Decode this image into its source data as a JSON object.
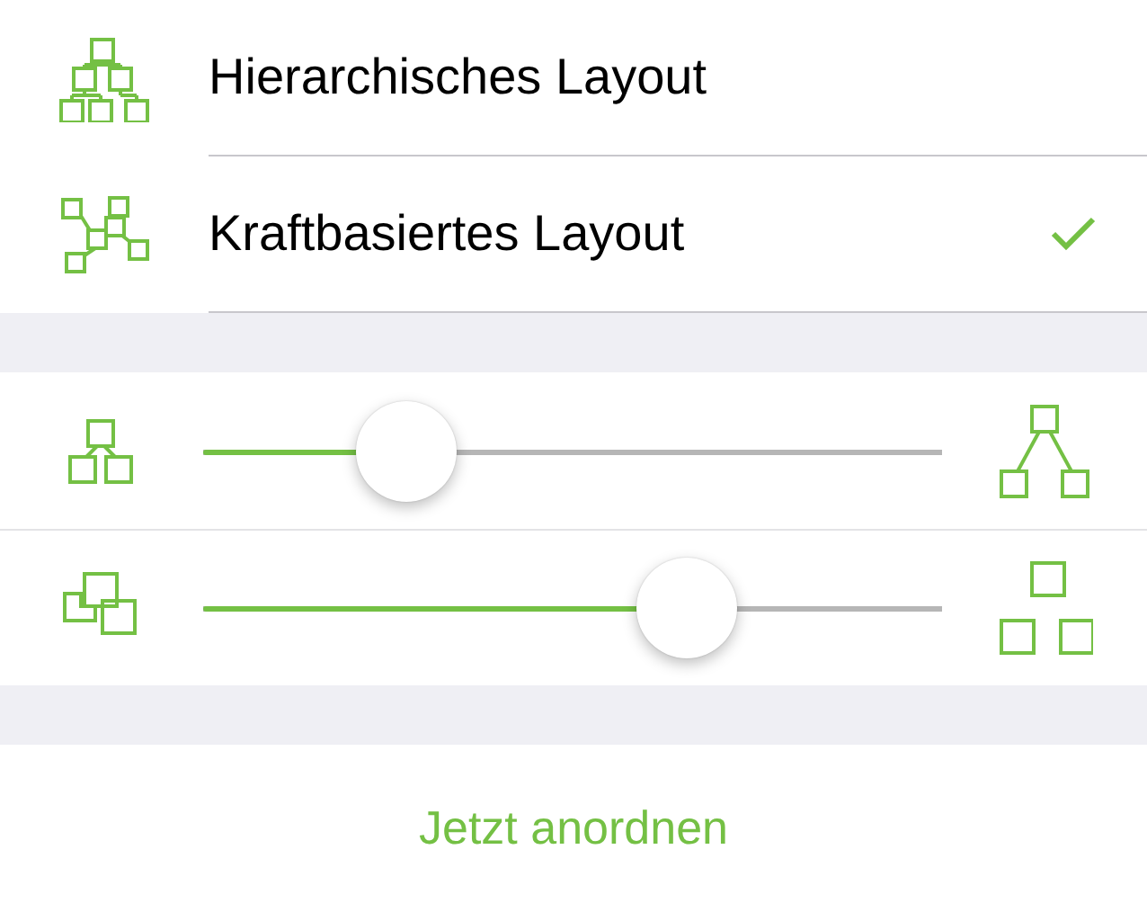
{
  "layouts": [
    {
      "kind": "hierarchical",
      "label": "Hierarchisches Layout",
      "selected": false
    },
    {
      "kind": "force",
      "label": "Kraftbasiertes Layout",
      "selected": true
    }
  ],
  "sliders": [
    {
      "kind": "spacing",
      "level": 0.275
    },
    {
      "kind": "overlap",
      "level": 0.655
    }
  ],
  "action": {
    "label": "Jetzt anordnen"
  }
}
